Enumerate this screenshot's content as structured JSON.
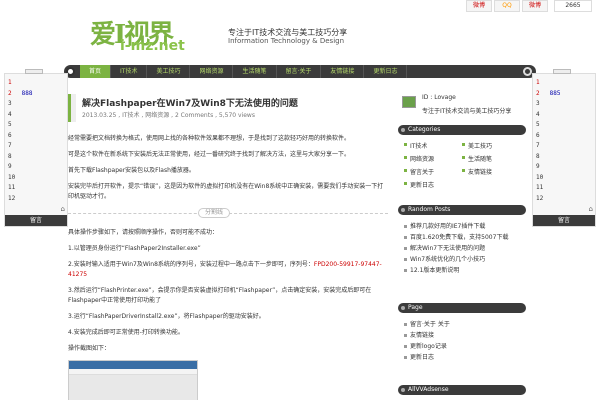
{
  "header": {
    "logo_zh": "爱I视界",
    "logo_en": "i-mz.net",
    "slogan": "专注于IT技术交流与美工技巧分享",
    "slogan_en": "Information Technology & Design",
    "social": [
      "微博",
      "QQ",
      "微博"
    ],
    "followers": "2665"
  },
  "nav": {
    "tabs": [
      "首页",
      "IT技术",
      "美工技巧",
      "网络资源",
      "生活随笔",
      "留言·关于",
      "友情链接",
      "更新日志"
    ]
  },
  "left_widget": {
    "lines": [
      {
        "n": "1",
        "v": "",
        "red": true
      },
      {
        "n": "2",
        "v": "888",
        "red": true
      },
      {
        "n": "3",
        "v": ""
      },
      {
        "n": "4",
        "v": ""
      },
      {
        "n": "5",
        "v": ""
      },
      {
        "n": "6",
        "v": ""
      },
      {
        "n": "7",
        "v": ""
      },
      {
        "n": "8",
        "v": ""
      },
      {
        "n": "9",
        "v": ""
      },
      {
        "n": "10",
        "v": ""
      },
      {
        "n": "11",
        "v": ""
      },
      {
        "n": "12",
        "v": ""
      }
    ],
    "footer": "留言"
  },
  "right_widget": {
    "lines": [
      {
        "n": "1",
        "v": "",
        "red": true
      },
      {
        "n": "2",
        "v": "885",
        "red": true
      },
      {
        "n": "3",
        "v": ""
      },
      {
        "n": "4",
        "v": ""
      },
      {
        "n": "5",
        "v": ""
      },
      {
        "n": "6",
        "v": ""
      },
      {
        "n": "7",
        "v": ""
      },
      {
        "n": "8",
        "v": ""
      },
      {
        "n": "9",
        "v": ""
      },
      {
        "n": "10",
        "v": ""
      },
      {
        "n": "11",
        "v": ""
      },
      {
        "n": "12",
        "v": ""
      }
    ],
    "footer": "留言"
  },
  "article": {
    "title": "解决Flashpaper在Win7及Win8下无法使用的问题",
    "meta": "2013.03.25 , IT技术 , 网络资源 , 2 Comments , 5,570 views",
    "paragraphs": [
      "经常需要把文档转换为格式，使用网上找的各种软件效果都不理想，于是找到了这款轻巧好用的转换软件。",
      "可是这个软件在新系统下安装后无法正常使用，经过一番研究终于找到了解决方法，这里与大家分享一下。",
      "首先下载Flashpaper安装包以及Flash播放器。",
      "安装完毕后打开软件，提示“错误”，这是因为软件的虚拟打印机没有在Win8系统中正确安装，需要我们手动安装一下打印机驱动才行。"
    ],
    "divider": "分割线",
    "steps": [
      "具体操作步骤如下，请按照顺序操作，否则可能不成功：",
      "1.以管理员身份运行“FlashPaper2Installer.exe”",
      "2.安装时输入适用于Win7及Win8系统的序列号，安装过程中一路点击下一步即可，序列号：",
      "3.然后运行“FlashPrinter.exe”，会提示你是否安装虚拟打印机“Flashpaper”，点击确定安装，安装完成后即可在Flashpaper中正常使用打印功能了",
      "3.运行“FlashPaperDriverInstall2.exe”，将Flashpaper的驱动安装好。",
      "4.安装完成后即可正常使用-打印转换功能。",
      "操作截图如下："
    ],
    "serial": "FPD200-59917-97447-41275"
  },
  "sidebar": {
    "id_label": "ID : Lovage",
    "desc": "专注于IT技术交流与美工技巧分享",
    "categories_title": "Categories",
    "categories": [
      "IT技术",
      "美工技巧",
      "网络资源",
      "生活随笔",
      "留言关于",
      "友情链接",
      "更新日志"
    ],
    "random_title": "Random Posts",
    "random": [
      "推荐几款好用的IE7插件下载",
      "百度1.620免费下载，支持5007下载",
      "解决Win7下无法使用的问题",
      "Win7系统优化的几个小技巧",
      "12.1版本更新说明"
    ],
    "page_title": "Page",
    "pages": [
      "留言·关于 关于",
      "友情链接",
      "更新logo记录",
      "更新日志"
    ],
    "ads_title": "AllVVAdsense"
  }
}
